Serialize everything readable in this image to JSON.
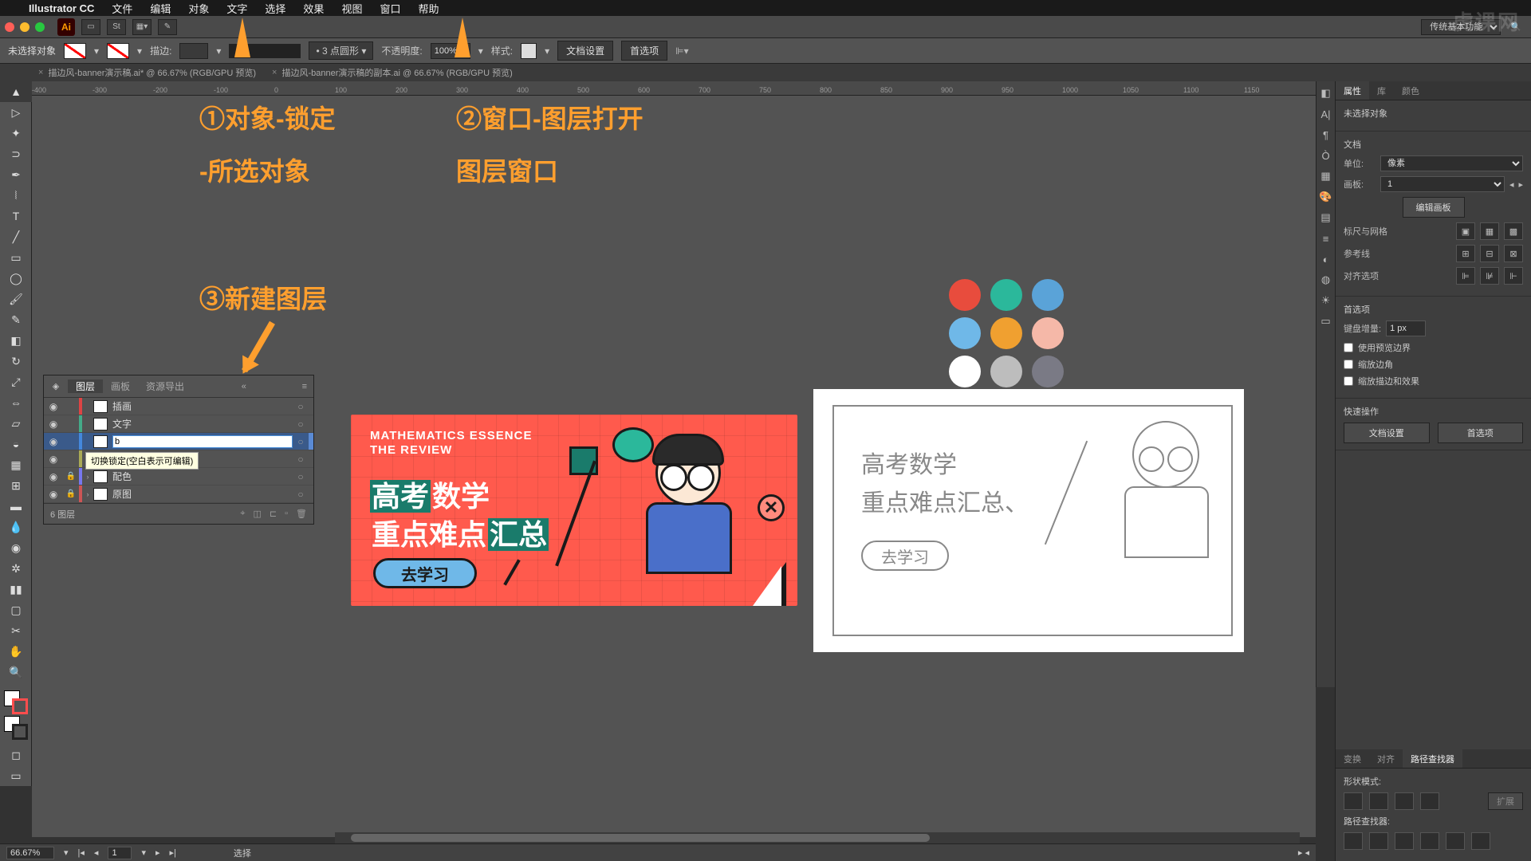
{
  "menubar": {
    "appname": "Illustrator CC",
    "items": [
      "文件",
      "编辑",
      "对象",
      "文字",
      "选择",
      "效果",
      "视图",
      "窗口",
      "帮助"
    ]
  },
  "chrome": {
    "workspace": "传统基本功能"
  },
  "controlbar": {
    "noselection": "未选择对象",
    "stroke_label": "描边:",
    "stroke_val": "",
    "dash_profile": "3 点圆形",
    "opacity_label": "不透明度:",
    "opacity_val": "100%",
    "style_label": "样式:",
    "docset": "文档设置",
    "prefs": "首选项"
  },
  "tabs": {
    "t1": "描边风-banner演示稿.ai* @ 66.67% (RGB/GPU 预览)",
    "t2": "描边风-banner演示稿的副本.ai @ 66.67% (RGB/GPU 预览)"
  },
  "ruler": {
    "marks": [
      "-400",
      "-300",
      "-200",
      "-100",
      "0",
      "100",
      "200",
      "300",
      "400",
      "500",
      "600",
      "700",
      "750",
      "800",
      "850",
      "900",
      "950",
      "1000",
      "1050",
      "1100",
      "1150"
    ]
  },
  "annotations": {
    "a1_l1": "①对象-锁定",
    "a1_l2": "-所选对象",
    "a2_l1": "②窗口-图层打开",
    "a2_l2": "图层窗口",
    "a3": "③新建图层"
  },
  "banner": {
    "en1": "MATHEMATICS ESSENCE",
    "en2": "THE REVIEW",
    "cn1_a": "高考",
    "cn1_b": "数学",
    "cn2_a": "重点难点",
    "cn2_b": "汇总",
    "golearn": "去学习"
  },
  "sketch": {
    "l1": "高考数学",
    "l2": "重点难点汇总、",
    "btn": "去学习"
  },
  "palette_colors": [
    "#e84c3d",
    "#2bb89b",
    "#5aa3d8",
    "#6fb8e8",
    "#f0a030",
    "#f5b8a8",
    "#ffffff",
    "#bdbdbd",
    "#7a7a85"
  ],
  "layers": {
    "tabs": [
      "图层",
      "画板",
      "资源导出"
    ],
    "rows": [
      {
        "name": "插画",
        "color": "#d44",
        "eye": true,
        "lock": false,
        "editing": false
      },
      {
        "name": "文字",
        "color": "#4a8",
        "eye": true,
        "lock": false,
        "editing": false
      },
      {
        "name": "b",
        "color": "#48d",
        "eye": true,
        "lock": false,
        "editing": true,
        "selected": true
      },
      {
        "name": "",
        "color": "#aa5",
        "eye": true,
        "lock": false,
        "editing": false
      },
      {
        "name": "配色",
        "color": "#77e",
        "eye": true,
        "lock": true,
        "expand": true
      },
      {
        "name": "原图",
        "color": "#c55",
        "eye": true,
        "lock": true,
        "expand": true
      }
    ],
    "tooltip": "切换锁定(空白表示可编辑)",
    "footer": "6 图层"
  },
  "props": {
    "tabs": [
      "属性",
      "库",
      "颜色"
    ],
    "noselection": "未选择对象",
    "doc_title": "文档",
    "unit_label": "单位:",
    "unit_val": "像素",
    "artboard_label": "画板:",
    "artboard_val": "1",
    "edit_artboard": "编辑画板",
    "ruler_grid": "标尺与网格",
    "guides": "参考线",
    "align_opts": "对齐选项",
    "prefs_title": "首选项",
    "key_inc_label": "键盘增量:",
    "key_inc_val": "1 px",
    "chk1": "使用预览边界",
    "chk2": "缩放边角",
    "chk3": "缩放描边和效果",
    "quick_title": "快速操作",
    "docset_btn": "文档设置",
    "prefs_btn": "首选项"
  },
  "pathfinder": {
    "tabs": [
      "变换",
      "对齐",
      "路径查找器"
    ],
    "shape_mode": "形状模式:",
    "expand": "扩展",
    "pf_label": "路径查找器:"
  },
  "status": {
    "zoom": "66.67%",
    "tool": "选择"
  },
  "watermark": "虎课网"
}
